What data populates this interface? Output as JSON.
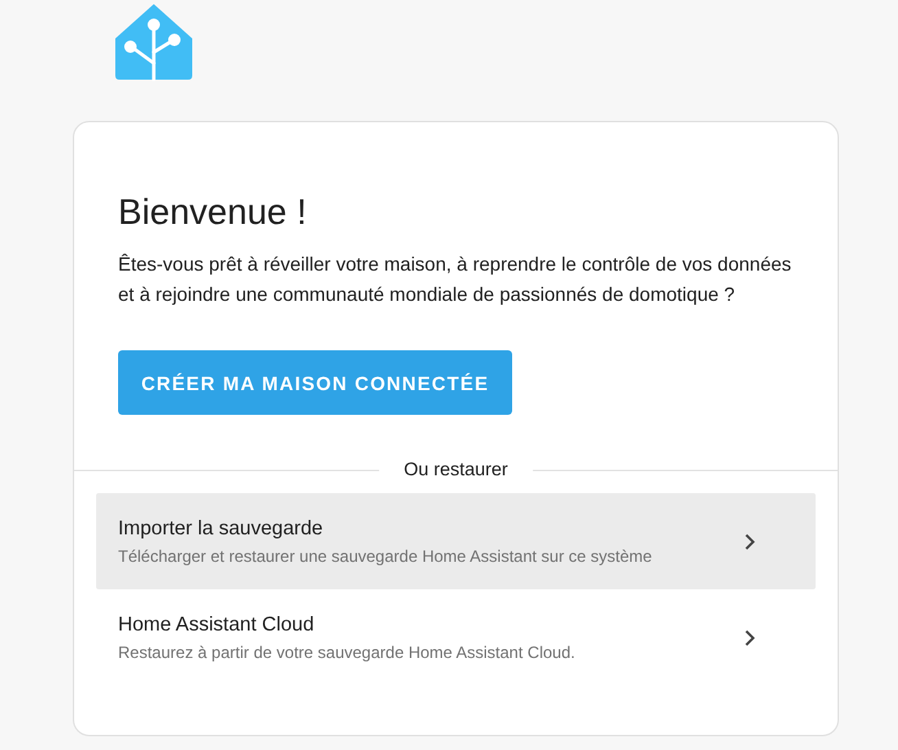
{
  "welcome": {
    "title": "Bienvenue !",
    "intro": "Êtes-vous prêt à réveiller votre maison, à reprendre le contrôle de vos données et à rejoindre une communauté mondiale de passionnés de domotique ?",
    "button": "CRÉER MA MAISON CONNECTÉE"
  },
  "restore": {
    "divider_label": "Ou restaurer",
    "options": [
      {
        "title": "Importer la sauvegarde",
        "description": "Télécharger et restaurer une sauvegarde Home Assistant sur ce système",
        "selected": true
      },
      {
        "title": "Home Assistant Cloud",
        "description": "Restaurez à partir de votre sauvegarde Home Assistant Cloud.",
        "selected": false
      }
    ]
  }
}
